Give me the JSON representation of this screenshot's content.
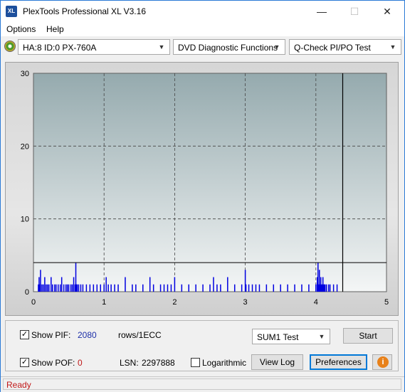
{
  "window": {
    "title": "PlexTools Professional XL V3.16",
    "icon_text": "XL"
  },
  "menu": {
    "options": "Options",
    "help": "Help"
  },
  "toolbar": {
    "drive": "HA:8 ID:0  PX-760A",
    "function": "DVD Diagnostic Functions",
    "test": "Q-Check PI/PO Test"
  },
  "chart_data": {
    "type": "bar",
    "x_ticks": [
      "0",
      "1",
      "2",
      "3",
      "4",
      "5"
    ],
    "y_ticks": [
      "0",
      "10",
      "20",
      "30"
    ],
    "xlim": [
      0,
      5
    ],
    "ylim": [
      0,
      30
    ],
    "grid": true,
    "threshold_line": 4,
    "end_marker_x": 4.38,
    "series": [
      {
        "color": "#0000e0",
        "x": [
          0.07,
          0.08,
          0.09,
          0.1,
          0.12,
          0.14,
          0.16,
          0.18,
          0.2,
          0.22,
          0.25,
          0.27,
          0.3,
          0.32,
          0.35,
          0.38,
          0.4,
          0.43,
          0.46,
          0.48,
          0.5,
          0.53,
          0.55,
          0.57,
          0.59,
          0.6,
          0.61,
          0.62,
          0.64,
          0.67,
          0.7,
          0.75,
          0.8,
          0.85,
          0.9,
          0.95,
          1.0,
          1.03,
          1.06,
          1.1,
          1.15,
          1.2,
          1.3,
          1.4,
          1.45,
          1.55,
          1.65,
          1.7,
          1.8,
          1.85,
          1.9,
          1.95,
          2.0,
          2.1,
          2.2,
          2.3,
          2.4,
          2.5,
          2.55,
          2.6,
          2.65,
          2.75,
          2.85,
          2.95,
          3.0,
          3.01,
          3.05,
          3.1,
          3.15,
          3.2,
          3.3,
          3.4,
          3.5,
          3.6,
          3.7,
          3.8,
          3.9,
          4.0,
          4.02,
          4.03,
          4.04,
          4.05,
          4.06,
          4.07,
          4.08,
          4.09,
          4.1,
          4.11,
          4.12,
          4.13,
          4.15,
          4.18,
          4.2,
          4.25,
          4.3
        ],
        "values": [
          1,
          2,
          1,
          3,
          1,
          1,
          2,
          1,
          1,
          1,
          2,
          1,
          1,
          1,
          1,
          1,
          2,
          1,
          1,
          1,
          1,
          1,
          1,
          2,
          1,
          4,
          1,
          1,
          1,
          1,
          1,
          1,
          1,
          1,
          1,
          1,
          1,
          2,
          1,
          1,
          1,
          1,
          2,
          1,
          1,
          1,
          2,
          1,
          1,
          1,
          1,
          1,
          2,
          1,
          1,
          1,
          1,
          1,
          2,
          1,
          1,
          2,
          1,
          1,
          3,
          1,
          1,
          1,
          1,
          1,
          1,
          1,
          1,
          1,
          1,
          1,
          1,
          1,
          2,
          4,
          1,
          3,
          1,
          2,
          1,
          1,
          2,
          1,
          1,
          1,
          1,
          1,
          1,
          1,
          1
        ]
      }
    ]
  },
  "controls": {
    "show_pif_label": "Show PIF:",
    "pif_value": "2080",
    "pif_unit": "rows/1ECC",
    "show_pof_label": "Show POF:",
    "pof_value": "0",
    "lsn_label": "LSN:",
    "lsn_value": "2297888",
    "logarithmic_label": "Logarithmic",
    "test_select": "SUM1 Test",
    "start": "Start",
    "view_log": "View Log",
    "preferences": "Preferences",
    "show_pif_checked": true,
    "show_pof_checked": true,
    "logarithmic_checked": false
  },
  "status": {
    "text": "Ready"
  },
  "colors": {
    "accent": "#0078d7",
    "status_red": "#c01818",
    "value_blue": "#1d2fa8",
    "bar_blue": "#0000e0"
  },
  "icons": [
    "app-logo-icon",
    "minimize-icon",
    "maximize-icon",
    "close-icon",
    "disc-drive-icon",
    "chevron-down-icon",
    "info-icon",
    "checkmark-icon"
  ]
}
